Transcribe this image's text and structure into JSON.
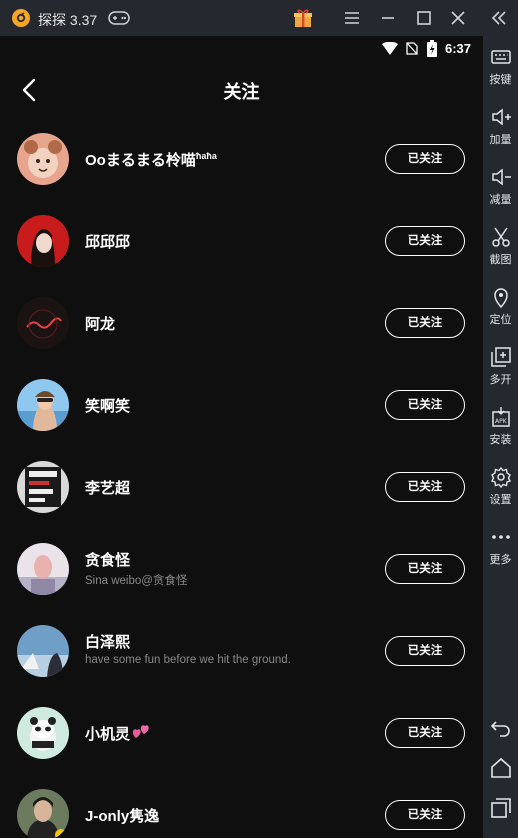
{
  "window": {
    "title": "探探 3.37"
  },
  "statusbar": {
    "time": "6:37"
  },
  "page": {
    "title": "关注"
  },
  "follow_list": [
    {
      "name": "Ooまるまる柃喵",
      "name_suffix": "ħaħa",
      "bio": "",
      "button": "已关注"
    },
    {
      "name": "邱邱邱",
      "name_suffix": "",
      "bio": "",
      "button": "已关注"
    },
    {
      "name": "阿龙",
      "name_suffix": "",
      "bio": "",
      "button": "已关注"
    },
    {
      "name": "笑啊笑",
      "name_suffix": "",
      "bio": "",
      "button": "已关注"
    },
    {
      "name": "李艺超",
      "name_suffix": "",
      "bio": "",
      "button": "已关注"
    },
    {
      "name": "贪食怪",
      "name_suffix": "",
      "bio": "Sina weibo@贪食怪",
      "button": "已关注"
    },
    {
      "name": "白泽熙",
      "name_suffix": "",
      "bio": "have some fun before we hit the ground.",
      "button": "已关注"
    },
    {
      "name": "小机灵",
      "name_suffix": "",
      "bio": "",
      "button": "已关注"
    },
    {
      "name": "J-only隽逸",
      "name_suffix": "",
      "bio": "",
      "button": "已关注"
    }
  ],
  "sidebar": {
    "items": [
      {
        "label": "按键",
        "icon": "keyboard-icon"
      },
      {
        "label": "加量",
        "icon": "volume-up-icon"
      },
      {
        "label": "减量",
        "icon": "volume-down-icon"
      },
      {
        "label": "截图",
        "icon": "scissors-icon"
      },
      {
        "label": "定位",
        "icon": "location-pin-icon"
      },
      {
        "label": "多开",
        "icon": "multi-window-icon"
      },
      {
        "label": "安装",
        "icon": "apk-install-icon"
      },
      {
        "label": "设置",
        "icon": "gear-icon"
      },
      {
        "label": "更多",
        "icon": "more-dots-icon"
      }
    ],
    "nav": [
      "back-arrow-icon",
      "home-icon",
      "recent-apps-icon"
    ]
  },
  "colors": {
    "background": "#0f0f0f",
    "chrome": "#262830",
    "text": "#ffffff",
    "secondary_text": "#8a8a8a",
    "logo": "#f5a623"
  }
}
